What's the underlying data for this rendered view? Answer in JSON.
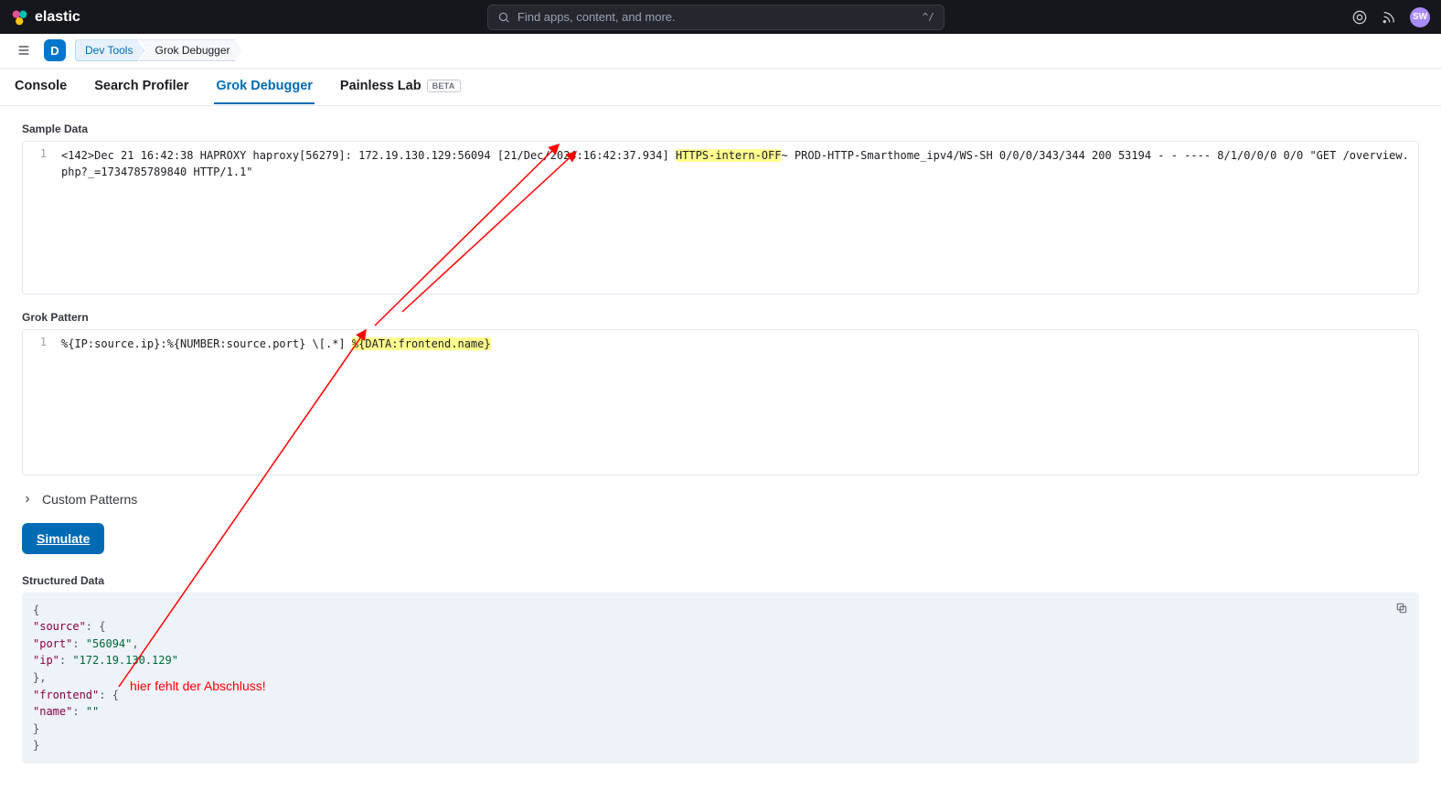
{
  "header": {
    "brand": "elastic",
    "search_placeholder": "Find apps, content, and more.",
    "search_kbd": "^/",
    "avatar_initials": "SW"
  },
  "crumbs": {
    "space_letter": "D",
    "items": [
      "Dev Tools",
      "Grok Debugger"
    ]
  },
  "tabs": {
    "items": [
      "Console",
      "Search Profiler",
      "Grok Debugger",
      "Painless Lab"
    ],
    "beta_label": "BETA",
    "active_index": 2
  },
  "sample": {
    "label": "Sample Data",
    "line_no": "1",
    "pre_text": "<142>Dec 21 16:42:38 HAPROXY haproxy[56279]: 172.19.130.129:56094 [21/Dec/2024:16:42:37.934] ",
    "hl_text": "HTTPS-intern-OFF",
    "post_text": "~ PROD-HTTP-Smarthome_ipv4/WS-SH 0/0/0/343/344 200 53194 - - ---- 8/1/0/0/0 0/0 \"GET /overview.php?_=1734785789840 HTTP/1.1\""
  },
  "grok": {
    "label": "Grok Pattern",
    "line_no": "1",
    "pre_text": "%{IP:source.ip}:%{NUMBER:source.port} \\[.*] ",
    "hl_text": "%{DATA:frontend.name}"
  },
  "custom_patterns_label": "Custom Patterns",
  "simulate_label": "Simulate",
  "structured": {
    "label": "Structured Data",
    "json_lines": [
      {
        "t": "punc",
        "v": "{"
      },
      {
        "t": "kv_open",
        "indent": 1,
        "k": "source"
      },
      {
        "t": "kv_str",
        "indent": 2,
        "k": "port",
        "v": "56094",
        "comma": true
      },
      {
        "t": "kv_str",
        "indent": 2,
        "k": "ip",
        "v": "172.19.130.129"
      },
      {
        "t": "close",
        "indent": 1,
        "comma": true
      },
      {
        "t": "kv_open",
        "indent": 1,
        "k": "frontend"
      },
      {
        "t": "kv_str",
        "indent": 2,
        "k": "name",
        "v": ""
      },
      {
        "t": "close",
        "indent": 1
      },
      {
        "t": "punc",
        "v": "}"
      }
    ]
  },
  "annotation_text": "hier fehlt der Abschluss!"
}
